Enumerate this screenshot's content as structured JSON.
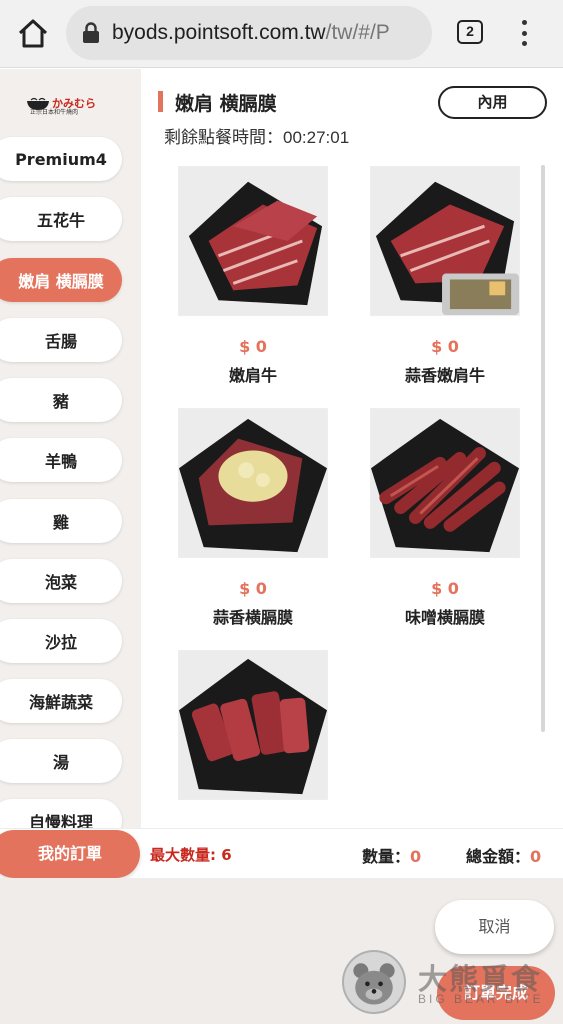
{
  "browser": {
    "url_host": "byods.pointsoft.com.tw",
    "url_path": "/tw/#/P",
    "tab_count": "2",
    "icons": [
      "home-icon",
      "lock-icon",
      "tabs-icon",
      "more-vert-icon"
    ]
  },
  "brand": {
    "logo_text": "かみむら",
    "logo_sub": "正宗日本和牛燒肉"
  },
  "sidebar": {
    "items": [
      {
        "label": "Premium4",
        "active": false
      },
      {
        "label": "五花牛",
        "active": false
      },
      {
        "label": "嫩肩 横膈膜",
        "active": true
      },
      {
        "label": "舌腸",
        "active": false
      },
      {
        "label": "豬",
        "active": false
      },
      {
        "label": "羊鴨",
        "active": false
      },
      {
        "label": "雞",
        "active": false
      },
      {
        "label": "泡菜",
        "active": false
      },
      {
        "label": "沙拉",
        "active": false
      },
      {
        "label": "海鮮蔬菜",
        "active": false
      },
      {
        "label": "湯",
        "active": false
      },
      {
        "label": "自慢料理",
        "active": false
      }
    ]
  },
  "main": {
    "category_title": "嫩肩 横膈膜",
    "dine_button": "內用",
    "timer_label": "剩餘點餐時間：",
    "timer_value": "00:27:01",
    "items": [
      {
        "price": "$ 0",
        "name": "嫩肩牛",
        "image": "sliced-beef-plate"
      },
      {
        "price": "$ 0",
        "name": "蒜香嫩肩牛",
        "image": "sliced-beef-garlic-tray"
      },
      {
        "price": "$ 0",
        "name": "蒜香横膈膜",
        "image": "beef-garlic-topping"
      },
      {
        "price": "$ 0",
        "name": "味噌横膈膜",
        "image": "miso-beef-strips"
      },
      {
        "price": "",
        "name": "",
        "image": "beef-chunks-plate"
      }
    ]
  },
  "order_bar": {
    "my_order": "我的訂單",
    "max_qty_label": "最大數量:",
    "max_qty_value": "6",
    "qty_label": "數量：",
    "qty_value": "0",
    "total_label": "總金額：",
    "total_value": "0"
  },
  "footer": {
    "cancel": "取消",
    "confirm": "訂單完成"
  },
  "watermark": {
    "title": "大熊覓食",
    "subtitle": "BIG BEAR BITE"
  },
  "colors": {
    "accent": "#e4735d",
    "red_text": "#c8281d",
    "sidebar_bg": "#f3efec"
  }
}
